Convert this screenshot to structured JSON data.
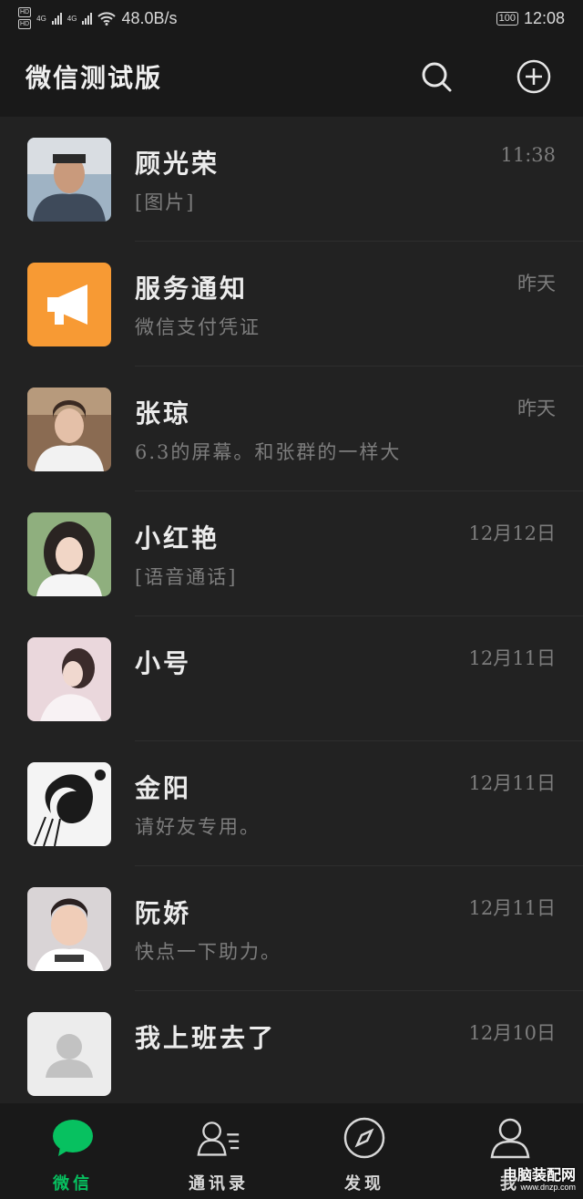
{
  "status_bar": {
    "net_speed": "48.0B/s",
    "battery": "100",
    "time": "12:08",
    "network_labels": [
      "HD",
      "HD",
      "4G",
      "4G"
    ]
  },
  "header": {
    "title": "微信测试版",
    "icons": [
      "search-icon",
      "plus-circle-icon"
    ]
  },
  "chats": [
    {
      "name": "顾光荣",
      "message": "[图片]",
      "time": "11:38",
      "avatar": "photo-man"
    },
    {
      "name": "服务通知",
      "message": "微信支付凭证",
      "time": "昨天",
      "avatar": "megaphone"
    },
    {
      "name": "张琼",
      "message": "6.3的屏幕。和张群的一样大",
      "time": "昨天",
      "avatar": "photo-woman"
    },
    {
      "name": "小红艳",
      "message": "[语音通话]",
      "time": "12月12日",
      "avatar": "photo-girl"
    },
    {
      "name": "小号",
      "message": "",
      "time": "12月11日",
      "avatar": "photo-pink"
    },
    {
      "name": "金阳",
      "message": "请好友专用。",
      "time": "12月11日",
      "avatar": "sketch"
    },
    {
      "name": "阮娇",
      "message": "快点一下助力。",
      "time": "12月11日",
      "avatar": "photo-child"
    },
    {
      "name": "我上班去了",
      "message": "",
      "time": "12月10日",
      "avatar": "default-user"
    }
  ],
  "tabs": [
    {
      "label": "微信",
      "icon": "chat-bubble-icon",
      "active": true
    },
    {
      "label": "通讯录",
      "icon": "contacts-icon",
      "active": false
    },
    {
      "label": "发现",
      "icon": "compass-icon",
      "active": false
    },
    {
      "label": "我",
      "icon": "person-icon",
      "active": false
    }
  ],
  "watermark": {
    "line1": "电脑装配网",
    "line2": "www.dnzp.com"
  },
  "colors": {
    "accent": "#07c160",
    "background": "#1f1f1f",
    "bar": "#191919",
    "service_orange": "#f79a34"
  }
}
